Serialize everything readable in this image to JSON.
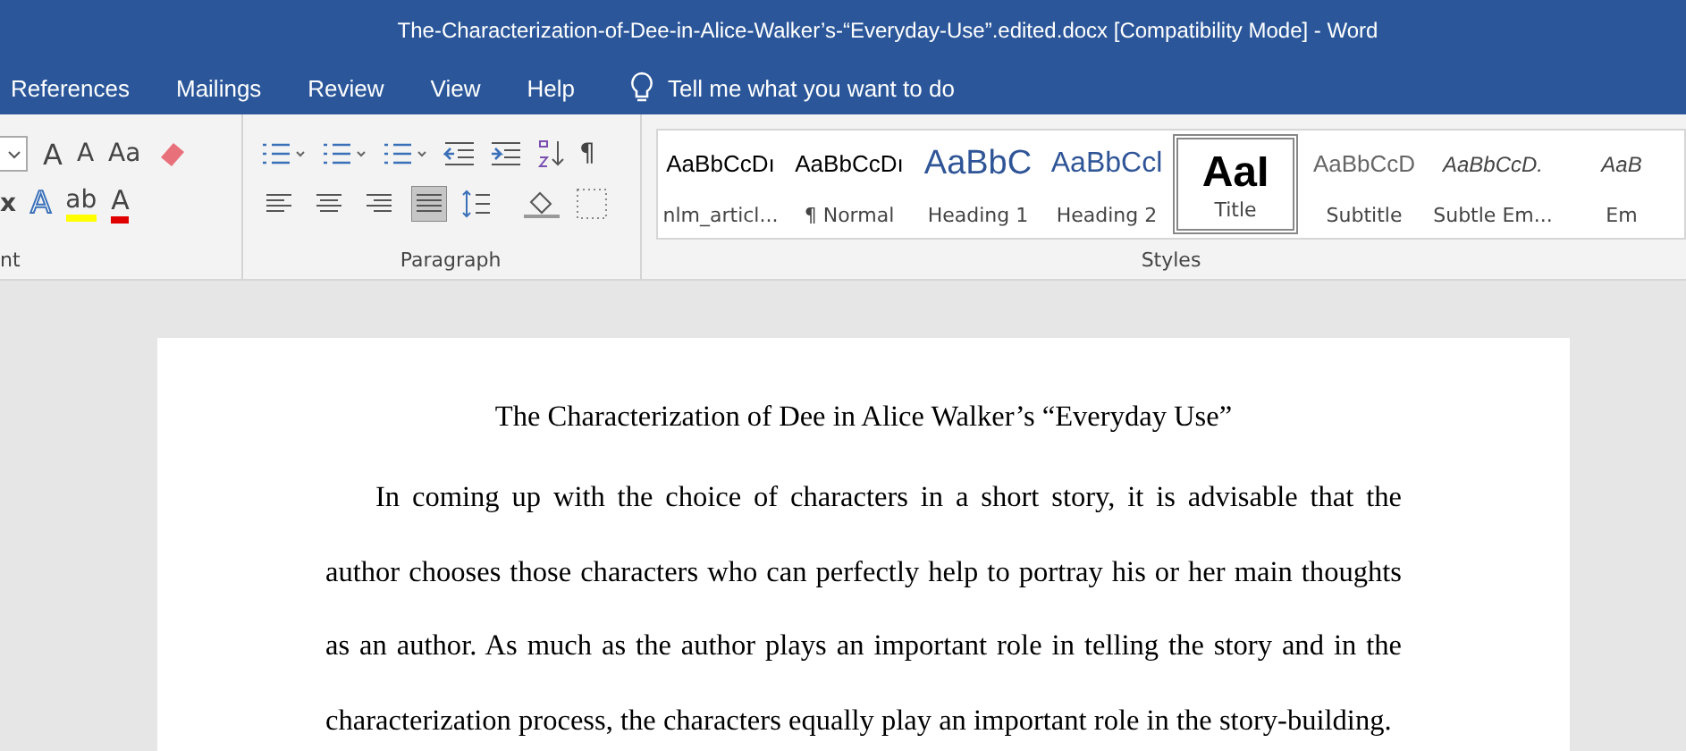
{
  "window": {
    "title": "The-Characterization-of-Dee-in-Alice-Walker’s-“Everyday-Use”.edited.docx [Compatibility Mode]  -  Word"
  },
  "tabs": [
    "References",
    "Mailings",
    "Review",
    "View",
    "Help"
  ],
  "tell_me": {
    "placeholder": "Tell me what you want to do"
  },
  "font_group": {
    "label": "nt",
    "row1": [
      {
        "kind": "combo"
      },
      {
        "kind": "grow",
        "text": "A"
      },
      {
        "kind": "shrink",
        "text": "A"
      },
      {
        "kind": "case",
        "text": "Aa"
      },
      {
        "kind": "clear"
      }
    ],
    "row2": [
      {
        "kind": "super",
        "text": "x"
      },
      {
        "kind": "effects",
        "text": "A"
      },
      {
        "kind": "highlight",
        "text": "ab"
      },
      {
        "kind": "fontcolor",
        "text": "A"
      }
    ]
  },
  "paragraph_group": {
    "label": "Paragraph",
    "alignment": [
      {
        "selected": false
      },
      {
        "selected": false
      },
      {
        "selected": false
      },
      {
        "selected": true
      }
    ],
    "pilcrow": "¶"
  },
  "styles_group": {
    "label": "Styles",
    "items": [
      {
        "kind": "plain",
        "preview": "AaBbCcDı",
        "name": "nlm_articl...",
        "selected": false
      },
      {
        "kind": "plain",
        "preview": "AaBbCcDı",
        "name": "¶ Normal",
        "selected": false
      },
      {
        "kind": "h1",
        "preview": "AaBbC",
        "name": "Heading 1",
        "selected": false
      },
      {
        "kind": "h2",
        "preview": "AaBbCcl",
        "name": "Heading 2",
        "selected": false
      },
      {
        "kind": "title",
        "preview": "AaI",
        "name": "Title",
        "selected": true
      },
      {
        "kind": "subtitle",
        "preview": "AaBbCcD",
        "name": "Subtitle",
        "selected": false
      },
      {
        "kind": "emph",
        "preview": "AaBbCcD.",
        "name": "Subtle Em...",
        "selected": false
      },
      {
        "kind": "emph",
        "preview": "AaB",
        "name": "Em",
        "selected": false
      }
    ]
  },
  "document": {
    "title": "The Characterization of Dee in Alice Walker’s “Everyday Use”",
    "paragraph": "In coming up with the choice of characters in a short story, it is advisable that the author chooses those characters who can perfectly help to portray his or her main thoughts as an author. As much as the author plays an important role in telling the story and in the characterization process, the characters equally play an important role in the story-building."
  }
}
